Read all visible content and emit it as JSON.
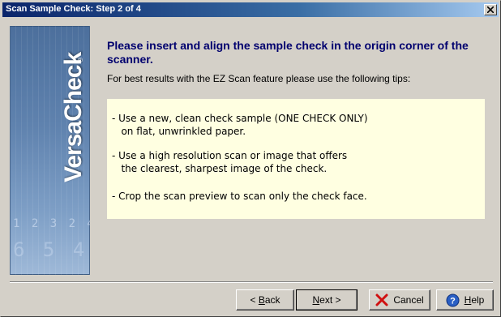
{
  "window": {
    "title": "Scan Sample Check: Step 2 of 4"
  },
  "sidebar": {
    "logo_text": "VersaCheck",
    "logo_mark": "®",
    "decor_digits_1": "1 2 3 2 4",
    "decor_digits_2": "6 5 4 3"
  },
  "content": {
    "heading": "Please insert and align the sample check in the origin corner of the scanner.",
    "intro": "For best results with the EZ Scan feature please use the following tips:",
    "tips": [
      "- Use a new, clean check sample (ONE CHECK ONLY)\n   on flat, unwrinkled paper.",
      "- Use a high resolution scan or image that offers\n   the clearest, sharpest image of the check.",
      "- Crop the scan preview to scan only the check face."
    ]
  },
  "buttons": {
    "back": {
      "prefix": "< ",
      "accel": "B",
      "rest": "ack"
    },
    "next": {
      "accel": "N",
      "rest": "ext >"
    },
    "cancel": {
      "label": "Cancel",
      "icon": "red-x-icon"
    },
    "help": {
      "accel": "H",
      "rest": "elp",
      "icon": "help-question-icon"
    }
  },
  "colors": {
    "heading": "#00006e",
    "tips_background": "#ffffe1",
    "dialog_background": "#d4d0c8",
    "titlebar_start": "#0a246a",
    "titlebar_end": "#a6caf0"
  }
}
